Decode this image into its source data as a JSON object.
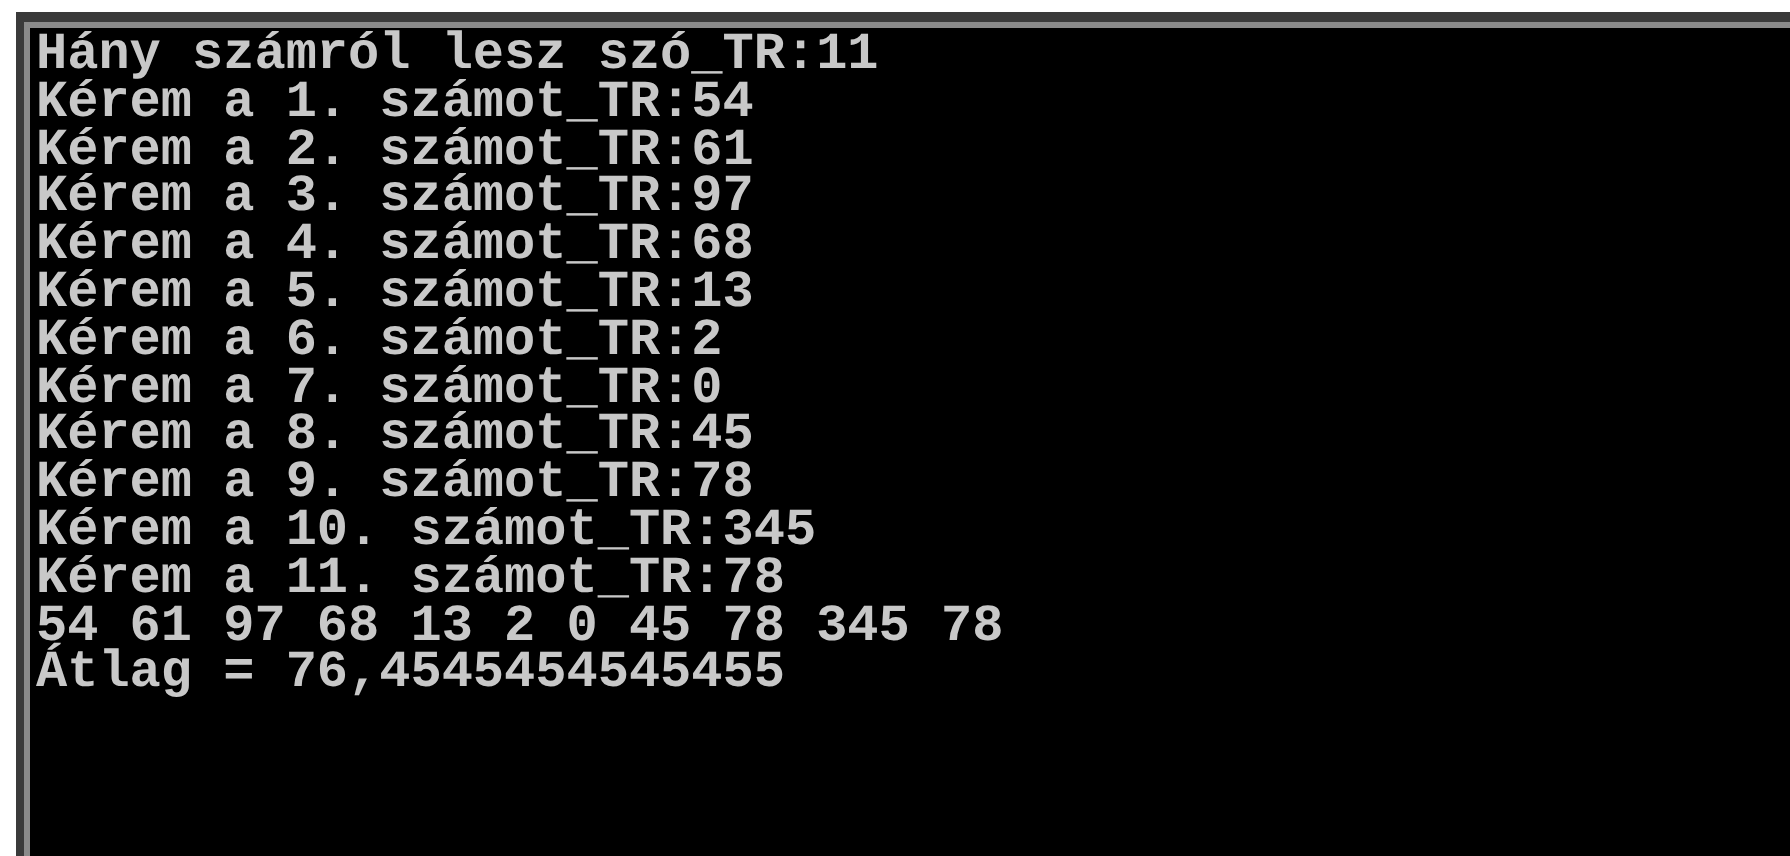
{
  "console": {
    "lines": [
      "Hány számról lesz szó_TR:11",
      "Kérem a 1. számot_TR:54",
      "Kérem a 2. számot_TR:61",
      "Kérem a 3. számot_TR:97",
      "Kérem a 4. számot_TR:68",
      "Kérem a 5. számot_TR:13",
      "Kérem a 6. számot_TR:2",
      "Kérem a 7. számot_TR:0",
      "Kérem a 8. számot_TR:45",
      "Kérem a 9. számot_TR:78",
      "Kérem a 10. számot_TR:345",
      "Kérem a 11. számot_TR:78",
      "54 61 97 68 13 2 0 45 78 345 78",
      "Átlag = 76,4545454545455"
    ]
  }
}
